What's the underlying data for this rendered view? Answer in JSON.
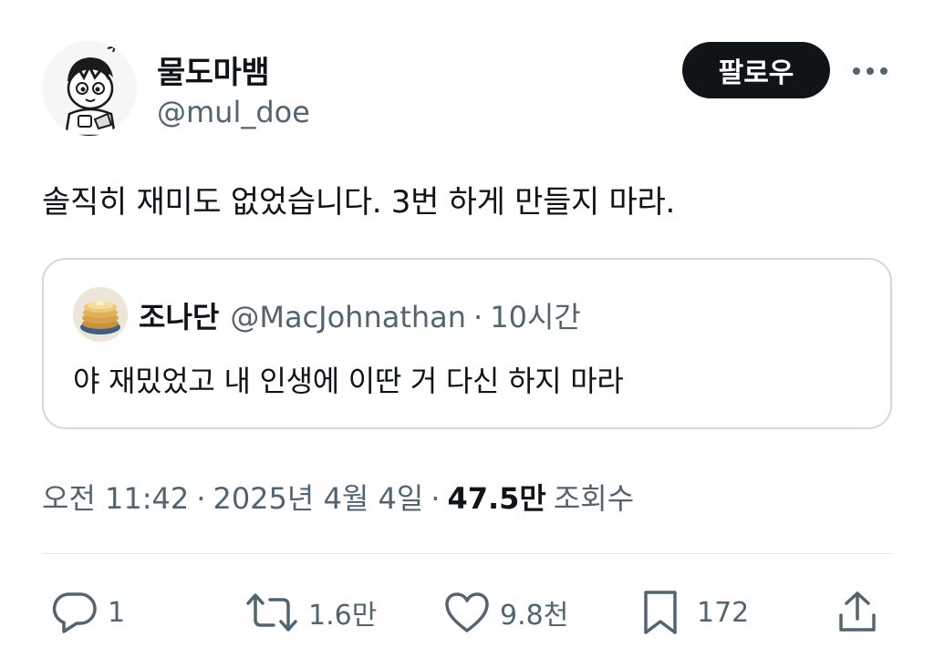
{
  "author": {
    "display_name": "물도마뱀",
    "handle": "@mul_doe"
  },
  "header": {
    "follow_label": "팔로우",
    "more_icon": "more-horizontal-icon"
  },
  "tweet": {
    "text": "솔직히 재미도 없었습니다. 3번 하게 만들지 마라."
  },
  "quote": {
    "display_name": "조나단",
    "handle": "@MacJohnathan",
    "separator": "·",
    "time": "10시간",
    "text": "야 재밌었고 내 인생에 이딴 거 다신 하지 마라"
  },
  "meta": {
    "time": "오전 11:42",
    "separator": "·",
    "date": "2025년 4월 4일",
    "views_count": "47.5만",
    "views_label": "조회수"
  },
  "actions": {
    "reply_count": "1",
    "retweet_count": "1.6만",
    "like_count": "9.8천",
    "bookmark_count": "172",
    "icons": [
      "reply-icon",
      "retweet-icon",
      "like-icon",
      "bookmark-icon",
      "share-icon"
    ]
  },
  "colors": {
    "text_primary": "#0f1419",
    "text_secondary": "#536471",
    "border": "#cfd9de",
    "follow_bg": "#0f1419"
  }
}
